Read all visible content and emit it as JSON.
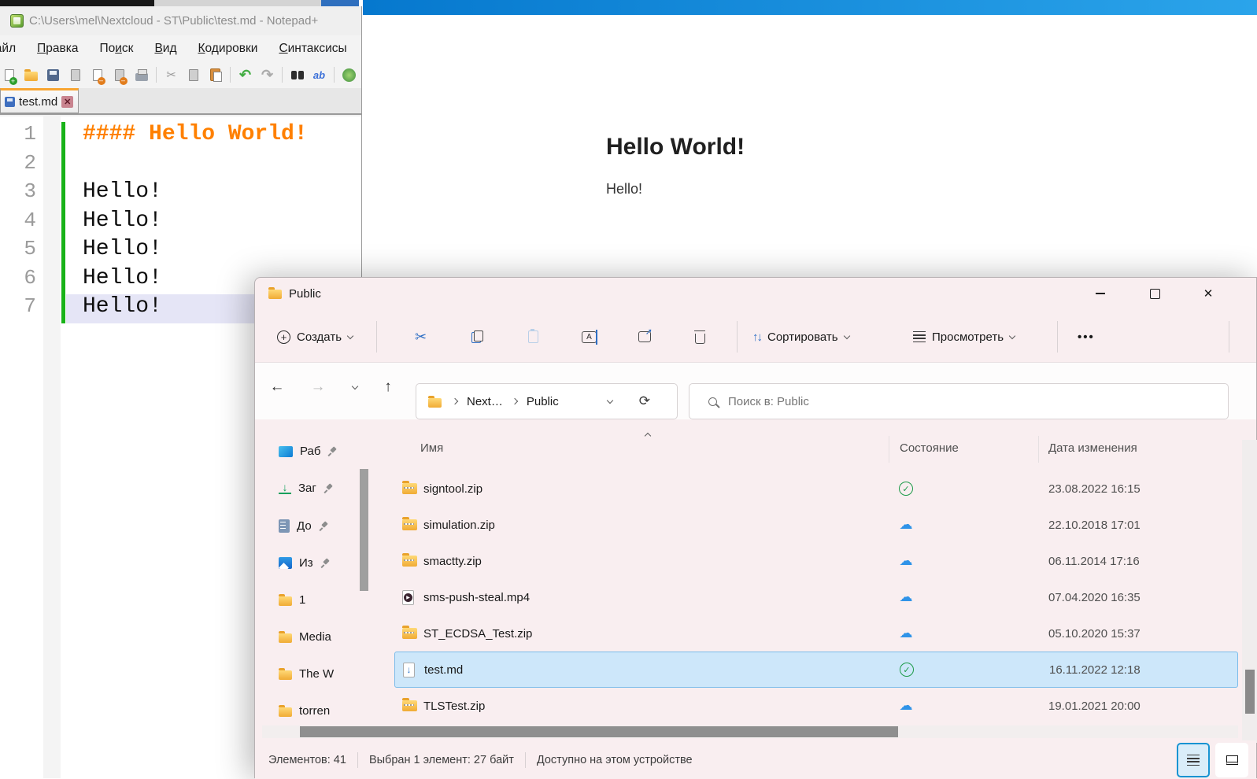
{
  "notepad": {
    "title": "C:\\Users\\mel\\Nextcloud - ST\\Public\\test.md - Notepad+",
    "menu": {
      "items": [
        {
          "pre": "",
          "accel": "Ф",
          "post": "айл"
        },
        {
          "pre": "",
          "accel": "П",
          "post": "равка"
        },
        {
          "pre": "По",
          "accel": "и",
          "post": "ск"
        },
        {
          "pre": "",
          "accel": "В",
          "post": "ид"
        },
        {
          "pre": "",
          "accel": "К",
          "post": "одировки"
        },
        {
          "pre": "",
          "accel": "С",
          "post": "интаксисы"
        }
      ]
    },
    "tab": {
      "label": "test.md"
    },
    "editor": {
      "lines": [
        {
          "num": "1",
          "text": "#### Hello World!"
        },
        {
          "num": "2",
          "text": ""
        },
        {
          "num": "3",
          "text": "Hello!"
        },
        {
          "num": "4",
          "text": "Hello!"
        },
        {
          "num": "5",
          "text": "Hello!"
        },
        {
          "num": "6",
          "text": "Hello!"
        },
        {
          "num": "7",
          "text": "Hello!"
        }
      ]
    }
  },
  "preview": {
    "heading": "Hello World!",
    "body": "Hello!"
  },
  "explorer": {
    "title": "Public",
    "toolbar": {
      "create_label": "Создать",
      "sort_label": "Сортировать",
      "view_label": "Просмотреть",
      "more_label": "•••"
    },
    "nav": {
      "breadcrumb": [
        "Next…",
        "Public"
      ]
    },
    "search": {
      "placeholder": "Поиск в: Public"
    },
    "sidebar": {
      "items": [
        {
          "label": "Раб",
          "pinned": true
        },
        {
          "label": "Заг",
          "pinned": true
        },
        {
          "label": "До",
          "pinned": true
        },
        {
          "label": "Из",
          "pinned": true
        },
        {
          "label": "1",
          "pinned": false
        },
        {
          "label": "Media",
          "pinned": false
        },
        {
          "label": "The W",
          "pinned": false
        },
        {
          "label": "torren",
          "pinned": false
        }
      ]
    },
    "list": {
      "columns": {
        "name": "Имя",
        "status": "Состояние",
        "date": "Дата изменения"
      },
      "files": [
        {
          "name": "signtool.zip",
          "date": "23.08.2022 16:15",
          "status": "synced"
        },
        {
          "name": "simulation.zip",
          "date": "22.10.2018 17:01",
          "status": "cloud"
        },
        {
          "name": "smactty.zip",
          "date": "06.11.2014 17:16",
          "status": "cloud"
        },
        {
          "name": "sms-push-steal.mp4",
          "date": "07.04.2020 16:35",
          "status": "cloud"
        },
        {
          "name": "ST_ECDSA_Test.zip",
          "date": "05.10.2020 15:37",
          "status": "cloud"
        },
        {
          "name": "test.md",
          "date": "16.11.2022 12:18",
          "status": "synced",
          "selected": true
        },
        {
          "name": "TLSTest.zip",
          "date": "19.01.2021 20:00",
          "status": "cloud"
        }
      ]
    },
    "status_bar": {
      "items_count": "Элементов: 41",
      "selection": "Выбран 1 элемент: 27 байт",
      "availability": "Доступно на этом устройстве"
    }
  },
  "glyphs": {
    "check": "✓",
    "cloud": "☁",
    "cut": "✂",
    "undo": "↶",
    "redo": "↷",
    "back": "←",
    "forward": "→",
    "up": "↑",
    "refresh": "⟳",
    "close": "✕",
    "play": "▶",
    "md_arrow": "↓",
    "replace": "ab"
  }
}
